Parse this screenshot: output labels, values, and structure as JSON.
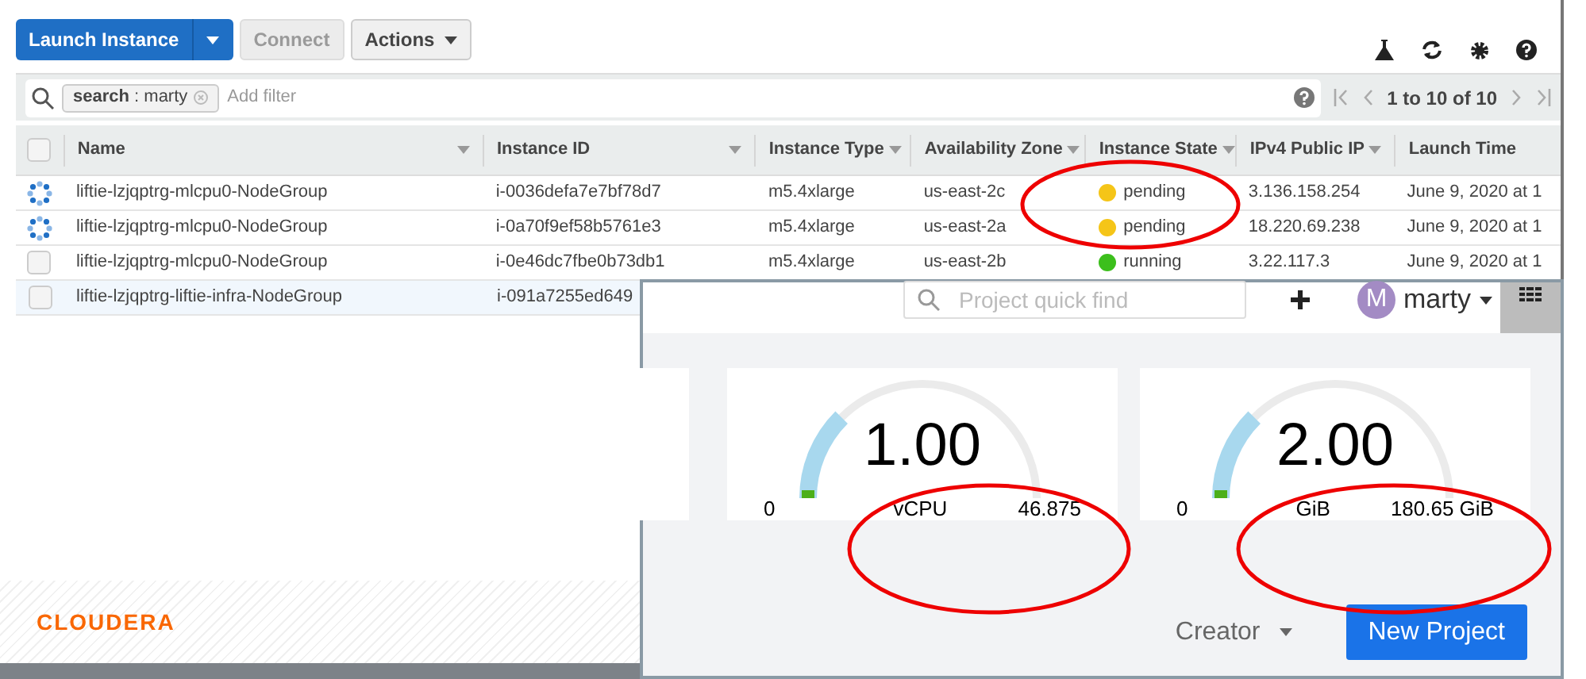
{
  "toolbar": {
    "launch_button": "Launch Instance",
    "connect_button": {
      "label": "Connect",
      "disabled": true
    },
    "actions_button": "Actions"
  },
  "filter": {
    "token": "**search** : marty",
    "placeholder": "Add filter",
    "pagination": "1 to 10 of 10"
  },
  "table": {
    "columns": [
      "Name",
      "Instance ID",
      "Instance Type",
      "Availability Zone",
      "Instance State",
      "IPv4 Public IP",
      "Launch Time"
    ],
    "select_all_checked": false,
    "rows": [
      {
        "busy": true,
        "highlighted": false,
        "cells": [
          "liftie-lzjqptrg-mlcpu0-NodeGroup",
          "i-0036defa7e7bf78d7",
          "m5.4xlarge",
          "us-east-2c",
          "pending",
          "3.136.158.254",
          "June 9, 2020 at 1"
        ],
        "color": "#f5c518"
      },
      {
        "busy": true,
        "highlighted": false,
        "cells": [
          "liftie-lzjqptrg-mlcpu0-NodeGroup",
          "i-0a70f9ef58b5761e3",
          "m5.4xlarge",
          "us-east-2a",
          "pending",
          "18.220.69.238",
          "June 9, 2020 at 1"
        ],
        "color": "#f5c518"
      },
      {
        "busy": false,
        "checked": false,
        "highlighted": false,
        "cells": [
          "liftie-lzjqptrg-mlcpu0-NodeGroup",
          "i-0e46dc7fbe0b73db1",
          "m5.4xlarge",
          "us-east-2b",
          "running",
          "3.22.117.3",
          "June 9, 2020 at 1"
        ],
        "color": "#3cbf1c"
      },
      {
        "busy": false,
        "checked": false,
        "highlighted": true,
        "cells": [
          "liftie-lzjqptrg-liftie-infra-NodeGroup",
          "i-091a7255ed649"
        ]
      }
    ]
  },
  "footer": {
    "logo": "CLOUDERA"
  },
  "workbench": {
    "search": {
      "placeholder": "Project quick find"
    },
    "user": {
      "initial": "M",
      "name": "marty"
    },
    "gauges": [
      {
        "value": "1.00",
        "min": "0",
        "unit": "vCPU",
        "max": "46.875"
      },
      {
        "value": "2.00",
        "min": "0",
        "unit": "GiB",
        "max": "180.65 GiB"
      }
    ],
    "filter_dropdown": "Creator",
    "new_project_button": "New Project"
  }
}
